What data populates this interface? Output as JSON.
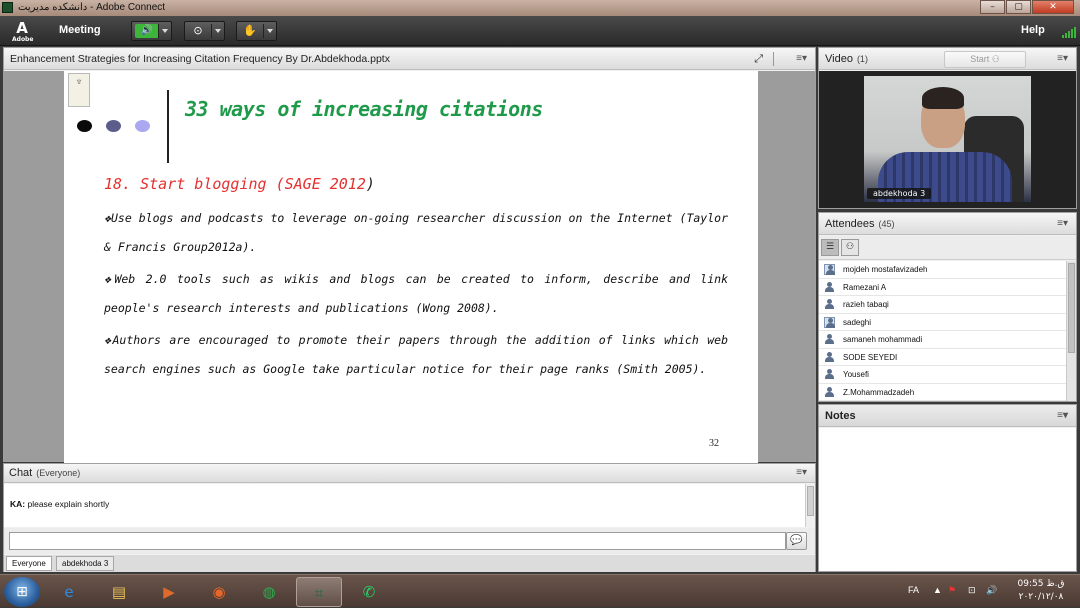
{
  "window": {
    "title": "دانشکده مدیریت - Adobe Connect",
    "buttons": [
      "–",
      "▢",
      "✕"
    ]
  },
  "menubar": {
    "logo_label": "A",
    "logo_small": "Adobe",
    "meeting_label": "Meeting",
    "help_label": "Help",
    "speaker_active": true,
    "colors": {
      "speaker_on": "#3db43a",
      "signal": "#3db43a"
    }
  },
  "share_pod": {
    "title": "Enhancement Strategies for Increasing Citation Frequency By Dr.Abdekhoda.pptx",
    "menu_icon": "≡▾",
    "fit_icon": "⤢"
  },
  "slide": {
    "logo_text": "۩",
    "dot_colors": [
      "#0a0a0a",
      "#5d5d8c",
      "#a9a8f0"
    ],
    "title": "33 ways of increasing citations",
    "title_color": "#1f9a4a",
    "heading": "18. Start blogging (SAGE 2012",
    "heading_close": ")",
    "heading_color": "#e53030",
    "paragraphs": [
      "❖Use blogs and podcasts to leverage on-going researcher discussion on the Internet (Taylor & Francis Group2012a).",
      "❖Web 2.0 tools such as wikis and blogs can be created to inform, describe and link people's research interests and publications (Wong 2008).",
      "❖Authors are encouraged to promote their papers through the addition of links which web search engines such as Google take particular notice for their page ranks (Smith 2005)."
    ],
    "page_number": "32"
  },
  "video_pod": {
    "title": "Video",
    "count": "(1)",
    "start_label": "Start",
    "camera_label": "abdekhoda 3"
  },
  "attendees_pod": {
    "title": "Attendees",
    "count": "(45)",
    "list": [
      {
        "name": "mojdeh mostafavizadeh",
        "host": true
      },
      {
        "name": "Ramezani A",
        "host": false
      },
      {
        "name": "razieh tabaqi",
        "host": false
      },
      {
        "name": "sadeghi",
        "host": true
      },
      {
        "name": "samaneh mohammadi",
        "host": false
      },
      {
        "name": "SODE SEYEDI",
        "host": false
      },
      {
        "name": "Yousefi",
        "host": false
      },
      {
        "name": "Z.Mohammadzadeh",
        "host": false
      }
    ]
  },
  "notes_pod": {
    "title": "Notes"
  },
  "chat_pod": {
    "title": "Chat",
    "scope": "(Everyone)",
    "messages": [
      {
        "sender": "KA:",
        "text": " please explain shortly"
      }
    ],
    "input_value": "",
    "send_icon": "💬",
    "tabs": [
      "Everyone",
      "abdekhoda 3"
    ]
  },
  "taskbar": {
    "apps": [
      {
        "name": "internet-explorer",
        "glyph": "e",
        "color": "#2f8be0",
        "active": false
      },
      {
        "name": "file-explorer",
        "glyph": "▤",
        "color": "#e8c25a",
        "active": false
      },
      {
        "name": "media-player",
        "glyph": "▶",
        "color": "#e06a2b",
        "active": false
      },
      {
        "name": "firefox",
        "glyph": "◉",
        "color": "#e8662a",
        "active": false
      },
      {
        "name": "chrome",
        "glyph": "◍",
        "color": "#2fa84f",
        "active": false
      },
      {
        "name": "adobe-connect",
        "glyph": "⌗",
        "color": "#1d6d3a",
        "active": true
      },
      {
        "name": "whatsapp",
        "glyph": "✆",
        "color": "#25d366",
        "active": false
      }
    ],
    "language": "FA",
    "time": "09:55 ق.ظ",
    "date": "۲۰۲۰/۱۲/۰۸"
  }
}
